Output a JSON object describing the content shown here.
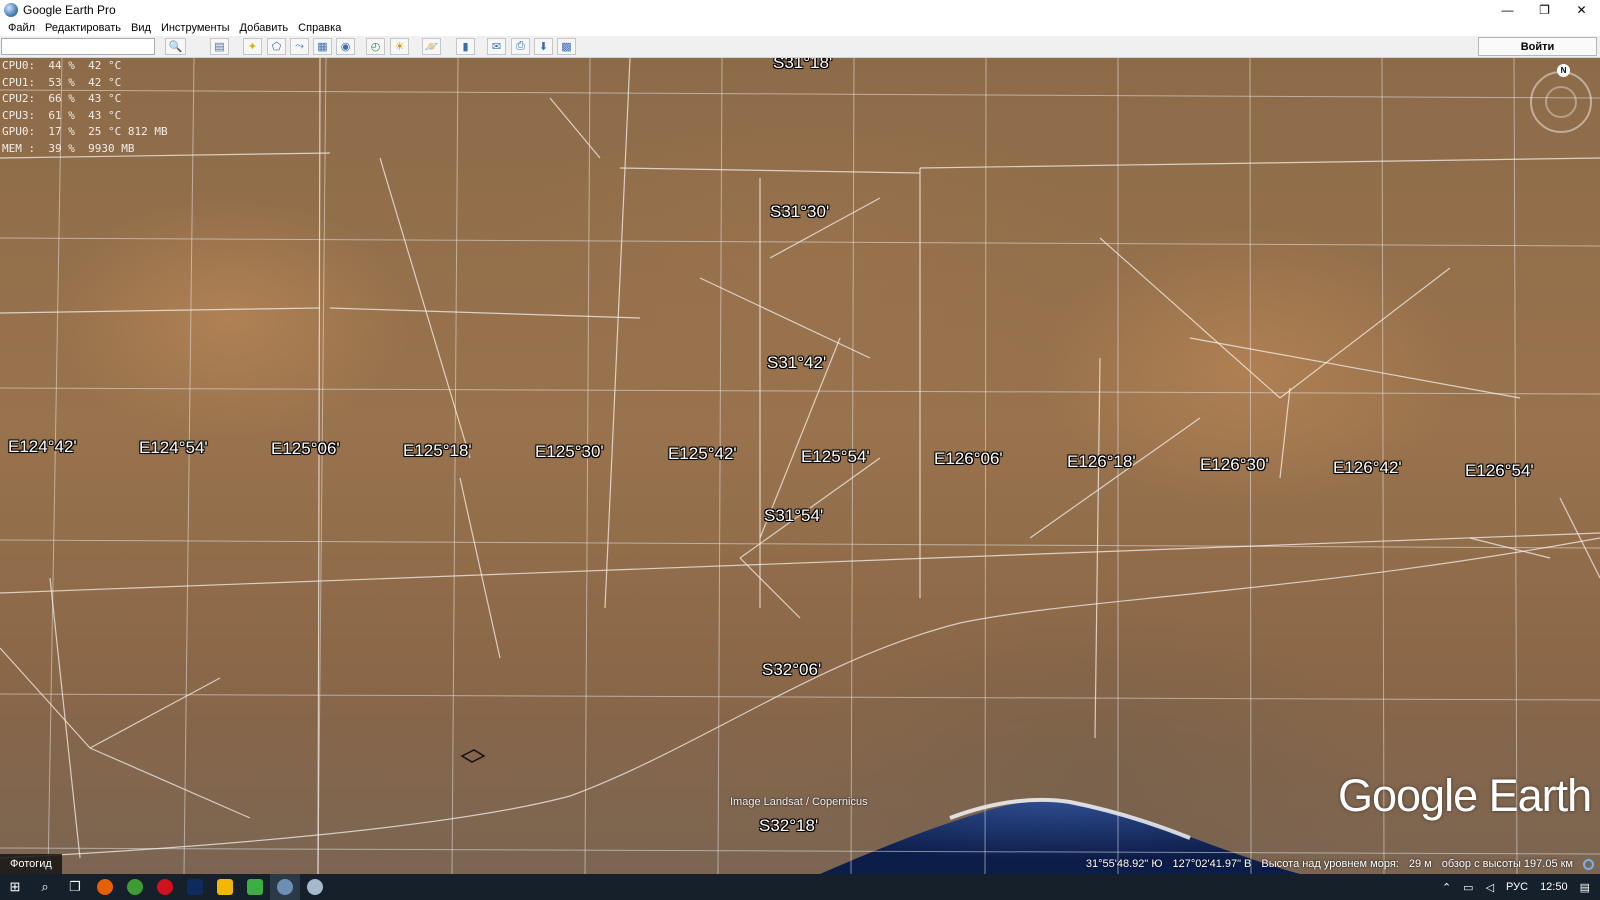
{
  "window": {
    "title": "Google Earth Pro",
    "controls": [
      "—",
      "❐",
      "✕"
    ]
  },
  "menu": [
    "Файл",
    "Редактировать",
    "Вид",
    "Инструменты",
    "Добавить",
    "Справка"
  ],
  "toolbar": {
    "search_value": "",
    "signin_label": "Войти"
  },
  "osd_lines": [
    "CPU0:  44 %  42 °C",
    "CPU1:  53 %  42 °C",
    "CPU2:  66 %  43 °C",
    "CPU3:  61 %  43 °C",
    "GPU0:  17 %  25 °C 812 MB",
    "MEM :  39 %  9930 MB"
  ],
  "grid_labels": {
    "lat": [
      "S31°18'",
      "S31°30'",
      "S31°42'",
      "S31°54'",
      "S32°06'",
      "S32°18'"
    ],
    "lon": [
      "E124°42'",
      "E124°54'",
      "E125°06'",
      "E125°18'",
      "E125°30'",
      "E125°42'",
      "E125°54'",
      "E126°06'",
      "E126°18'",
      "E126°30'",
      "E126°42'",
      "E126°54'"
    ]
  },
  "compass": {
    "north": "N"
  },
  "imagery_credit": "Image Landsat / Copernicus",
  "logo": "Google Earth",
  "status": {
    "tour_button": "Фотогид",
    "lat": "31°55'48.92\" Ю",
    "lon": "127°02'41.97\" В",
    "elev_label": "Высота над уровнем моря:",
    "elev_value": "29 м",
    "eye_alt": "обзор с высоты 197.05 км"
  },
  "taskbar": {
    "lang": "РУС",
    "time": "12:50",
    "apps": [
      {
        "name": "firefox",
        "color": "#e66000"
      },
      {
        "name": "chrome",
        "color": "#3f9c35"
      },
      {
        "name": "opera",
        "color": "#d0121c"
      },
      {
        "name": "photoshop",
        "color": "#0f2a5c"
      },
      {
        "name": "explorer",
        "color": "#f2b800"
      },
      {
        "name": "greenshot",
        "color": "#3dae43"
      },
      {
        "name": "google-earth",
        "color": "#6c8fb5"
      },
      {
        "name": "google-earth-2",
        "color": "#a5b8cc"
      }
    ]
  }
}
